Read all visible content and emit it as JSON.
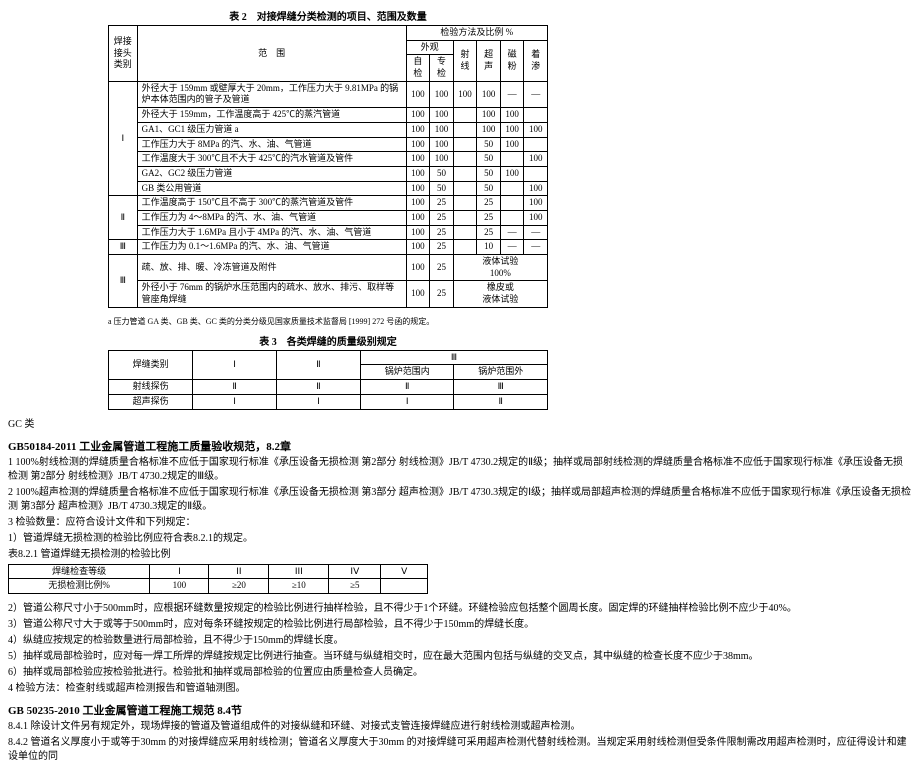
{
  "table2": {
    "caption": "表 2　对接焊缝分类检测的项目、范围及数量",
    "headers": {
      "joint_cat": "焊接接头类别",
      "range": "范　围",
      "method_group": "检验方法及比例\n%",
      "outer": "外观",
      "self": "自检",
      "spec": "专检",
      "rt": "射线",
      "ut": "超声",
      "mt": "磁粉",
      "pt": "着渗"
    },
    "groups": [
      {
        "cat": "Ⅰ",
        "rows": [
          {
            "range": "外径大于 159mm 或壁厚大于 20mm，工作压力大于 9.81MPa 的锅炉本体范围内的管子及管道",
            "v": [
              "100",
              "100",
              "100",
              "100",
              "—",
              "—"
            ]
          },
          {
            "range": "外径大于 159mm，工作温度高于 425℃的蒸汽管道",
            "v": [
              "100",
              "100",
              "",
              "100",
              "100",
              ""
            ]
          },
          {
            "range": "GA1、GC1 级压力管道 a",
            "v": [
              "100",
              "100",
              "",
              "100",
              "100",
              "100"
            ]
          },
          {
            "range": "工作压力大于 8MPa 的汽、水、油、气管道",
            "v": [
              "100",
              "100",
              "",
              "50",
              "100",
              ""
            ]
          },
          {
            "range": "工作温度大于 300℃且不大于 425℃的汽水管道及管件",
            "v": [
              "100",
              "100",
              "",
              "50",
              "",
              "100"
            ]
          },
          {
            "range": "GA2、GC2 级压力管道",
            "v": [
              "100",
              "50",
              "",
              "50",
              "100",
              ""
            ]
          },
          {
            "range": "GB 类公用管道",
            "v": [
              "100",
              "50",
              "",
              "50",
              "",
              "100",
              "—"
            ]
          }
        ]
      },
      {
        "cat": "Ⅱ",
        "rows": [
          {
            "range": "工作温度高于 150℃且不高于 300℃的蒸汽管道及管件",
            "v": [
              "100",
              "25",
              "",
              "25",
              "",
              "100",
              "—"
            ]
          },
          {
            "range": "工作压力为 4～8MPa 的汽、水、油、气管道",
            "v": [
              "100",
              "25",
              "",
              "25",
              "",
              "100",
              "—"
            ]
          },
          {
            "range": "工作压力大于 1.6MPa 且小于 4MPa 的汽、水、油、气管道",
            "v": [
              "100",
              "25",
              "",
              "25",
              "—",
              "—",
              "—"
            ]
          }
        ]
      },
      {
        "cat": "Ⅲ",
        "rows": [
          {
            "range": "工作压力为 0.1～1.6MPa 的汽、水、油、气管道",
            "v": [
              "100",
              "25",
              "",
              "10",
              "—",
              "—",
              "—"
            ]
          }
        ]
      },
      {
        "cat": "Ⅲ",
        "rows": [
          {
            "range": "疏、放、排、暖、冷冻管道及附件",
            "v": [
              "100",
              "25",
              "液体试验\n100%",
              "",
              "",
              "",
              ""
            ]
          },
          {
            "range": "外径小于 76mm 的锅炉水压范围内的疏水、放水、排污、取样等管座角焊缝",
            "v": [
              "100",
              "25",
              "橡皮或\n液体试验",
              "",
              "",
              "",
              ""
            ]
          }
        ]
      }
    ],
    "footnote": "a 压力管道 GA 类、GB 类、GC 类的分类分级见国家质量技术监督局 [1999] 272 号函的规定。"
  },
  "table3": {
    "caption": "表 3　各类焊缝的质量级别规定",
    "headers": {
      "cat": "焊缝类别",
      "c1": "Ⅰ",
      "c2": "Ⅱ",
      "c3": "Ⅲ",
      "in": "锅炉范围内",
      "out": "锅炉范围外"
    },
    "rows": [
      {
        "name": "射线探伤",
        "v": [
          "Ⅱ",
          "Ⅱ",
          "Ⅱ",
          "Ⅲ"
        ]
      },
      {
        "name": "超声探伤",
        "v": [
          "Ⅰ",
          "Ⅰ",
          "Ⅰ",
          "Ⅱ"
        ]
      }
    ]
  },
  "body1": {
    "gc": "GC 类",
    "h1": "GB50184-2011 工业金属管道工程施工质量验收规范，8.2章",
    "p1": "1 100%射线检测的焊缝质量合格标准不应低于国家现行标准《承压设备无损检测 第2部分 射线检测》JB/T 4730.2规定的Ⅱ级；抽样或局部射线检测的焊缝质量合格标准不应低于国家现行标准《承压设备无损检测 第2部分 射线检测》JB/T 4730.2规定的Ⅲ级。",
    "p2": "2 100%超声检测的焊缝质量合格标准不应低于国家现行标准《承压设备无损检测 第3部分 超声检测》JB/T 4730.3规定的Ⅰ级；抽样或局部超声检测的焊缝质量合格标准不应低于国家现行标准《承压设备无损检测 第3部分 超声检测》JB/T 4730.3规定的Ⅱ级。",
    "p3": "3 检验数量：应符合设计文件和下列规定：",
    "p4": "1）管道焊缝无损检测的检验比例应符合表8.2.1的规定。",
    "tcap": "表8.2.1 管道焊缝无损检测的检验比例"
  },
  "table4": {
    "headers": {
      "grade": "焊缝检查等级",
      "c1": "Ⅰ",
      "c2": "ⅠⅠ",
      "c3": "ⅠⅠⅠ",
      "c4": "ⅠⅤ",
      "c5": "Ⅴ"
    },
    "row": {
      "name": "无损检测比例%",
      "v": [
        "100",
        "≥20",
        "≥10",
        "≥5",
        ""
      ]
    }
  },
  "body2": {
    "p1": "2）管道公称尺寸小于500mm时，应根据环缝数量按规定的检验比例进行抽样检验，且不得少于1个环缝。环缝检验应包括整个圆周长度。固定焊的环缝抽样检验比例不应少于40%。",
    "p2": "3）管道公称尺寸大于或等于500mm时，应对每条环缝按规定的检验比例进行局部检验，且不得少于150mm的焊缝长度。",
    "p3": "4）纵缝应按规定的检验数量进行局部检验，且不得少于150mm的焊缝长度。",
    "p4": "5）抽样或局部检验时，应对每一焊工所焊的焊缝按规定比例进行抽查。当环缝与纵缝相交时，应在最大范围内包括与纵缝的交叉点，其中纵缝的检查长度不应少于38mm。",
    "p5": "6）抽样或局部检验应按检验批进行。检验批和抽样或局部检验的位置应由质量检查人员确定。",
    "p6": "4 检验方法：检查射线或超声检测报告和管道轴测图。"
  },
  "body3": {
    "h": "GB 50235-2010 工业金属管道工程施工规范 8.4节",
    "p1": "8.4.1 除设计文件另有规定外，现场焊接的管道及管道组成件的对接纵缝和环缝、对接式支管连接焊缝应进行射线检测或超声检测。",
    "p2": "8.4.2 管道名义厚度小于或等于30mm 的对接焊缝应采用射线检测；管道名义厚度大于30mm 的对接焊缝可采用超声检测代替射线检测。当规定采用射线检测但受条件限制需改用超声检测时，应征得设计和建设单位的同"
  }
}
